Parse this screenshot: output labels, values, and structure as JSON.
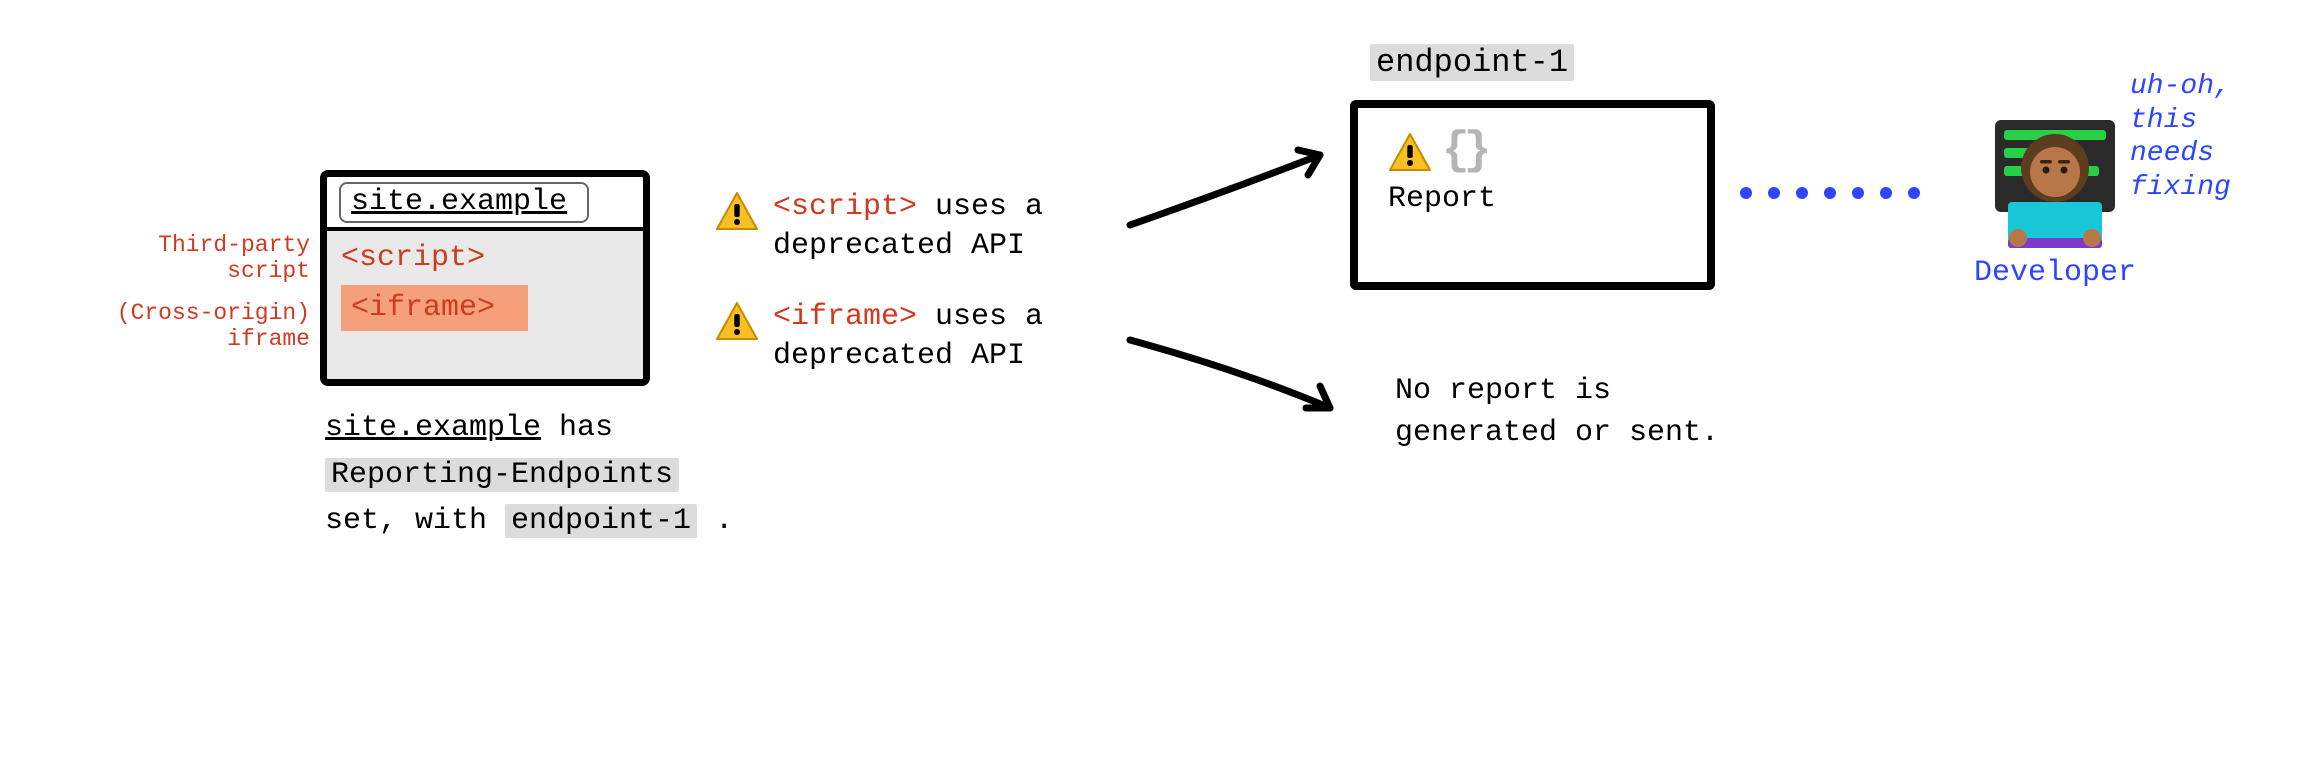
{
  "browser": {
    "url": "site.example",
    "script_tag": "<script>",
    "iframe_tag": "<iframe>"
  },
  "side_labels": {
    "third_party": "Third-party\nscript",
    "cross_origin": "(Cross-origin)\niframe"
  },
  "caption": {
    "part1_underlined": "site.example",
    "part1_rest": " has",
    "part2_badge": "Reporting-Endpoints",
    "part3_pre": "set, with ",
    "part3_badge": "endpoint-1",
    "part3_post": " ."
  },
  "warnings": {
    "script": {
      "code": "<script>",
      "rest": " uses a\ndeprecated API"
    },
    "iframe": {
      "code": "<iframe>",
      "rest": " uses a\ndeprecated API"
    }
  },
  "endpoint": {
    "title": "endpoint-1",
    "braces": "{}",
    "report_label": "Report"
  },
  "no_report": "No report is\ngenerated or sent.",
  "developer": {
    "label": "Developer",
    "thought": "uh-oh,\nthis\nneeds\nfixing"
  },
  "icons": {
    "warning": "warning-icon",
    "braces": "braces-icon",
    "developer": "developer-avatar"
  }
}
